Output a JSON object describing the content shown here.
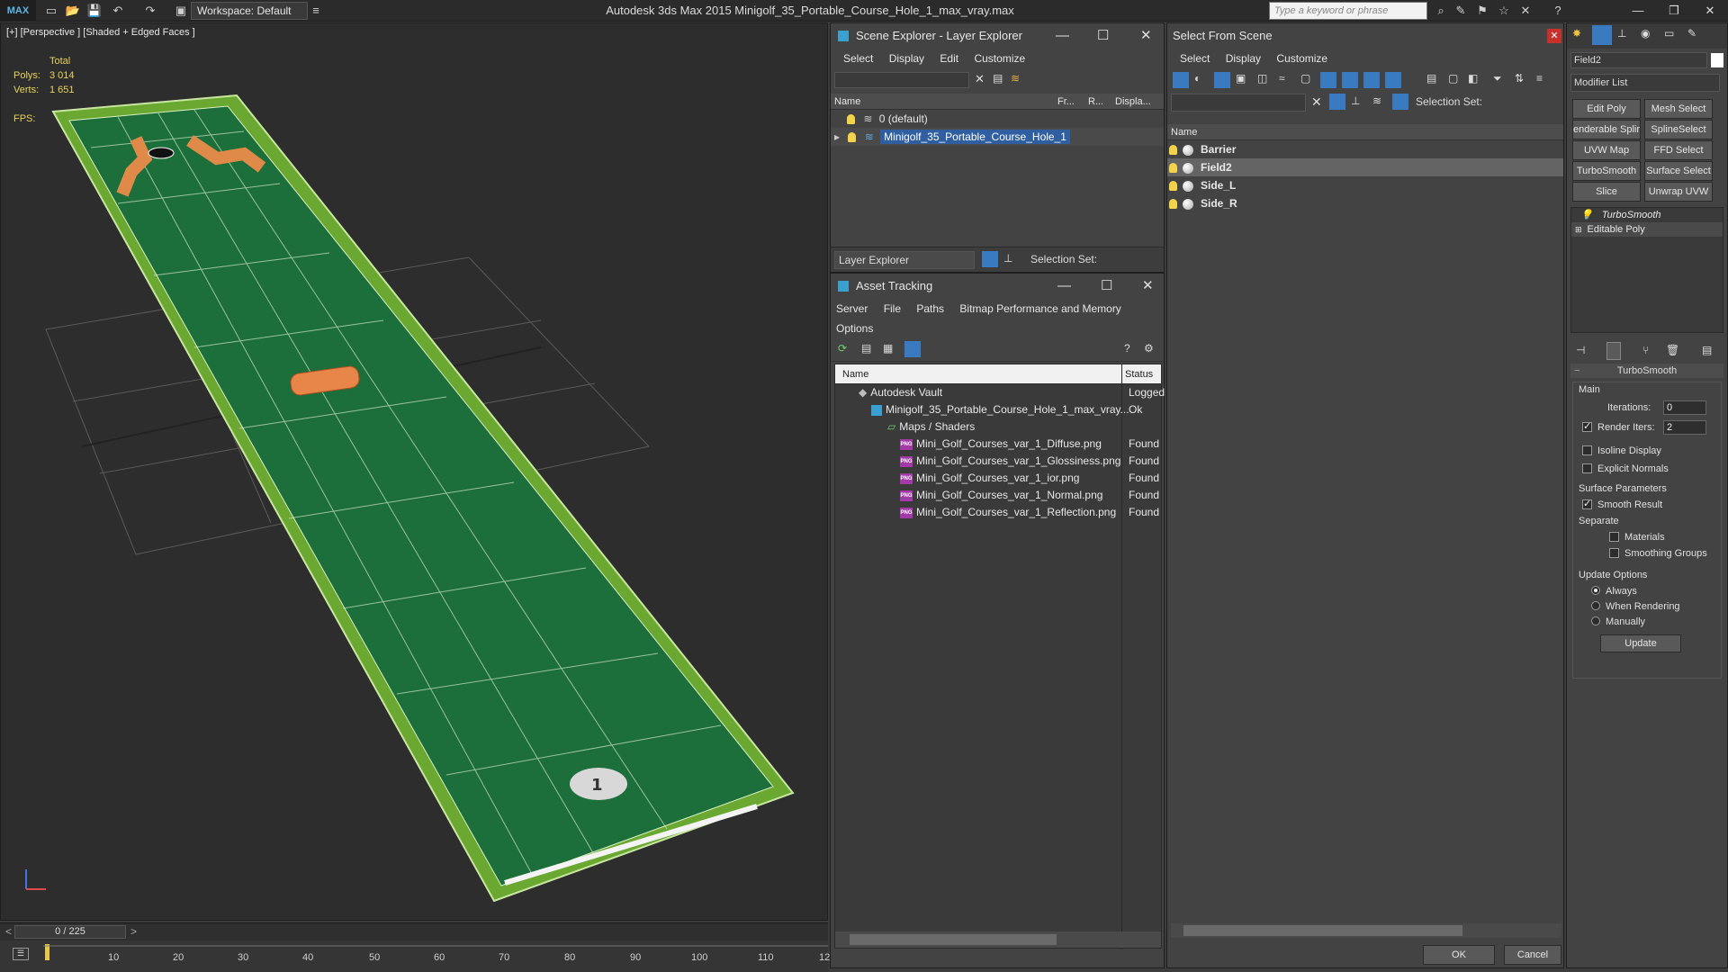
{
  "titlebar": {
    "logo": "MAX",
    "workspace": "Workspace: Default",
    "app_title": "Autodesk 3ds Max  2015     Minigolf_35_Portable_Course_Hole_1_max_vray.max",
    "search_placeholder": "Type a keyword or phrase"
  },
  "viewport": {
    "label": "[+] [Perspective ] [Shaded + Edged Faces ]",
    "stats_total": "Total",
    "polys_label": "Polys:",
    "polys_value": "3 014",
    "verts_label": "Verts:",
    "verts_value": "1 651",
    "fps_label": "FPS:"
  },
  "timeline": {
    "frame_counter": "0 / 225",
    "ticks": [
      "10",
      "20",
      "30",
      "40",
      "50",
      "60",
      "70",
      "80",
      "90",
      "100",
      "110",
      "12"
    ]
  },
  "scene_explorer": {
    "title": "Scene Explorer - Layer Explorer",
    "menu": [
      "Select",
      "Display",
      "Edit",
      "Customize"
    ],
    "columns": [
      "Name",
      "Fr...",
      "R...",
      "Displa..."
    ],
    "rows": [
      "0 (default)",
      "Minigolf_35_Portable_Course_Hole_1"
    ],
    "footer_label": "Layer Explorer",
    "selection_set": "Selection Set:"
  },
  "asset_tracking": {
    "title": "Asset Tracking",
    "menu": [
      "Server",
      "File",
      "Paths",
      "Bitmap Performance and Memory"
    ],
    "menu2": "Options",
    "columns": [
      "Name",
      "Status"
    ],
    "rows": [
      {
        "name": "Autodesk Vault",
        "status": "Logged"
      },
      {
        "name": "Minigolf_35_Portable_Course_Hole_1_max_vray...",
        "status": "Ok"
      },
      {
        "name": "Maps / Shaders",
        "status": ""
      },
      {
        "name": "Mini_Golf_Courses_var_1_Diffuse.png",
        "status": "Found"
      },
      {
        "name": "Mini_Golf_Courses_var_1_Glossiness.png",
        "status": "Found"
      },
      {
        "name": "Mini_Golf_Courses_var_1_ior.png",
        "status": "Found"
      },
      {
        "name": "Mini_Golf_Courses_var_1_Normal.png",
        "status": "Found"
      },
      {
        "name": "Mini_Golf_Courses_var_1_Reflection.png",
        "status": "Found"
      }
    ]
  },
  "select_from_scene": {
    "title": "Select From Scene",
    "menu": [
      "Select",
      "Display",
      "Customize"
    ],
    "selection_set": "Selection Set:",
    "column": "Name",
    "rows": [
      "Barrier",
      "Field2",
      "Side_L",
      "Side_R"
    ],
    "selected": "Field2",
    "ok": "OK",
    "cancel": "Cancel"
  },
  "command_panel": {
    "object_name": "Field2",
    "modifier_list": "Modifier List",
    "buttons": [
      "Edit Poly",
      "Mesh Select",
      "enderable Splir",
      "SplineSelect",
      "UVW Map",
      "FFD Select",
      "TurboSmooth",
      "Surface Select",
      "Slice",
      "Unwrap UVW"
    ],
    "stack": [
      "TurboSmooth",
      "Editable Poly"
    ],
    "rollout_title": "TurboSmooth",
    "main": "Main",
    "iterations_label": "Iterations:",
    "iterations_value": "0",
    "render_iters_label": "Render Iters:",
    "render_iters_value": "2",
    "isoline": "Isoline Display",
    "explicit_normals": "Explicit Normals",
    "surface_params": "Surface Parameters",
    "smooth_result": "Smooth Result",
    "separate": "Separate",
    "materials": "Materials",
    "smoothing_groups": "Smoothing Groups",
    "update_options": "Update Options",
    "always": "Always",
    "when_rendering": "When Rendering",
    "manually": "Manually",
    "update_btn": "Update"
  }
}
